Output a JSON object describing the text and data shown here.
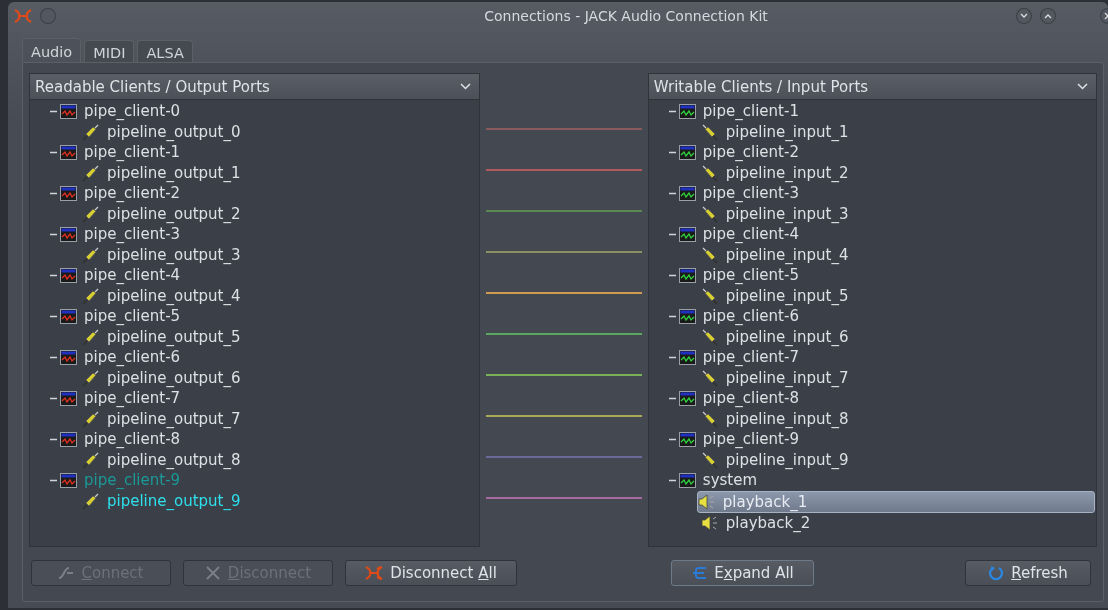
{
  "window": {
    "title": "Connections - JACK Audio Connection Kit"
  },
  "tabs": [
    {
      "label": "Audio",
      "selected": true
    },
    {
      "label": "MIDI",
      "selected": false
    },
    {
      "label": "ALSA",
      "selected": false
    }
  ],
  "readable": {
    "header": "Readable Clients / Output Ports",
    "clients": [
      {
        "name": "pipe_client-0",
        "expanded": true,
        "selected": false,
        "ports": [
          {
            "name": "pipeline_output_0",
            "kind": "plug",
            "selected": false
          }
        ]
      },
      {
        "name": "pipe_client-1",
        "expanded": true,
        "selected": false,
        "ports": [
          {
            "name": "pipeline_output_1",
            "kind": "plug",
            "selected": false
          }
        ]
      },
      {
        "name": "pipe_client-2",
        "expanded": true,
        "selected": false,
        "ports": [
          {
            "name": "pipeline_output_2",
            "kind": "plug",
            "selected": false
          }
        ]
      },
      {
        "name": "pipe_client-3",
        "expanded": true,
        "selected": false,
        "ports": [
          {
            "name": "pipeline_output_3",
            "kind": "plug",
            "selected": false
          }
        ]
      },
      {
        "name": "pipe_client-4",
        "expanded": true,
        "selected": false,
        "ports": [
          {
            "name": "pipeline_output_4",
            "kind": "plug",
            "selected": false
          }
        ]
      },
      {
        "name": "pipe_client-5",
        "expanded": true,
        "selected": false,
        "ports": [
          {
            "name": "pipeline_output_5",
            "kind": "plug",
            "selected": false
          }
        ]
      },
      {
        "name": "pipe_client-6",
        "expanded": true,
        "selected": false,
        "ports": [
          {
            "name": "pipeline_output_6",
            "kind": "plug",
            "selected": false
          }
        ]
      },
      {
        "name": "pipe_client-7",
        "expanded": true,
        "selected": false,
        "ports": [
          {
            "name": "pipeline_output_7",
            "kind": "plug",
            "selected": false
          }
        ]
      },
      {
        "name": "pipe_client-8",
        "expanded": true,
        "selected": false,
        "ports": [
          {
            "name": "pipeline_output_8",
            "kind": "plug",
            "selected": false
          }
        ]
      },
      {
        "name": "pipe_client-9",
        "expanded": true,
        "selected": true,
        "ports": [
          {
            "name": "pipeline_output_9",
            "kind": "plug",
            "selected": true
          }
        ]
      }
    ]
  },
  "connections": [
    {
      "color": "#8a5a5c"
    },
    {
      "color": "#b05a5e"
    },
    {
      "color": "#5a8a52"
    },
    {
      "color": "#8a9060"
    },
    {
      "color": "#d09a50"
    },
    {
      "color": "#5aa860"
    },
    {
      "color": "#7ab058"
    },
    {
      "color": "#a8a858"
    },
    {
      "color": "#6a6a98"
    },
    {
      "color": "#a868a0"
    }
  ],
  "writable": {
    "header": "Writable Clients / Input Ports",
    "clients": [
      {
        "name": "pipe_client-1",
        "expanded": true,
        "selected": false,
        "ports": [
          {
            "name": "pipeline_input_1",
            "kind": "plug",
            "selected": false
          }
        ]
      },
      {
        "name": "pipe_client-2",
        "expanded": true,
        "selected": false,
        "ports": [
          {
            "name": "pipeline_input_2",
            "kind": "plug",
            "selected": false
          }
        ]
      },
      {
        "name": "pipe_client-3",
        "expanded": true,
        "selected": false,
        "ports": [
          {
            "name": "pipeline_input_3",
            "kind": "plug",
            "selected": false
          }
        ]
      },
      {
        "name": "pipe_client-4",
        "expanded": true,
        "selected": false,
        "ports": [
          {
            "name": "pipeline_input_4",
            "kind": "plug",
            "selected": false
          }
        ]
      },
      {
        "name": "pipe_client-5",
        "expanded": true,
        "selected": false,
        "ports": [
          {
            "name": "pipeline_input_5",
            "kind": "plug",
            "selected": false
          }
        ]
      },
      {
        "name": "pipe_client-6",
        "expanded": true,
        "selected": false,
        "ports": [
          {
            "name": "pipeline_input_6",
            "kind": "plug",
            "selected": false
          }
        ]
      },
      {
        "name": "pipe_client-7",
        "expanded": true,
        "selected": false,
        "ports": [
          {
            "name": "pipeline_input_7",
            "kind": "plug",
            "selected": false
          }
        ]
      },
      {
        "name": "pipe_client-8",
        "expanded": true,
        "selected": false,
        "ports": [
          {
            "name": "pipeline_input_8",
            "kind": "plug",
            "selected": false
          }
        ]
      },
      {
        "name": "pipe_client-9",
        "expanded": true,
        "selected": false,
        "ports": [
          {
            "name": "pipeline_input_9",
            "kind": "plug",
            "selected": false
          }
        ]
      },
      {
        "name": "system",
        "expanded": true,
        "selected": false,
        "ports": [
          {
            "name": "playback_1",
            "kind": "speaker",
            "selected": true
          },
          {
            "name": "playback_2",
            "kind": "speaker",
            "selected": false
          }
        ]
      }
    ]
  },
  "left_buttons": [
    {
      "kind": "connect",
      "key": "C",
      "after": "onnect",
      "disabled": true
    },
    {
      "kind": "disconnect",
      "key": "D",
      "after": "isconnect",
      "disabled": true
    },
    {
      "kind": "disconnect_all",
      "before": "Disconnect ",
      "key": "A",
      "after": "ll",
      "disabled": false
    }
  ],
  "right_buttons": [
    {
      "kind": "expand",
      "before": "E",
      "key": "x",
      "after": "pand All",
      "disabled": false
    },
    {
      "kind": "refresh",
      "key": "R",
      "after": "efresh",
      "disabled": false
    }
  ]
}
